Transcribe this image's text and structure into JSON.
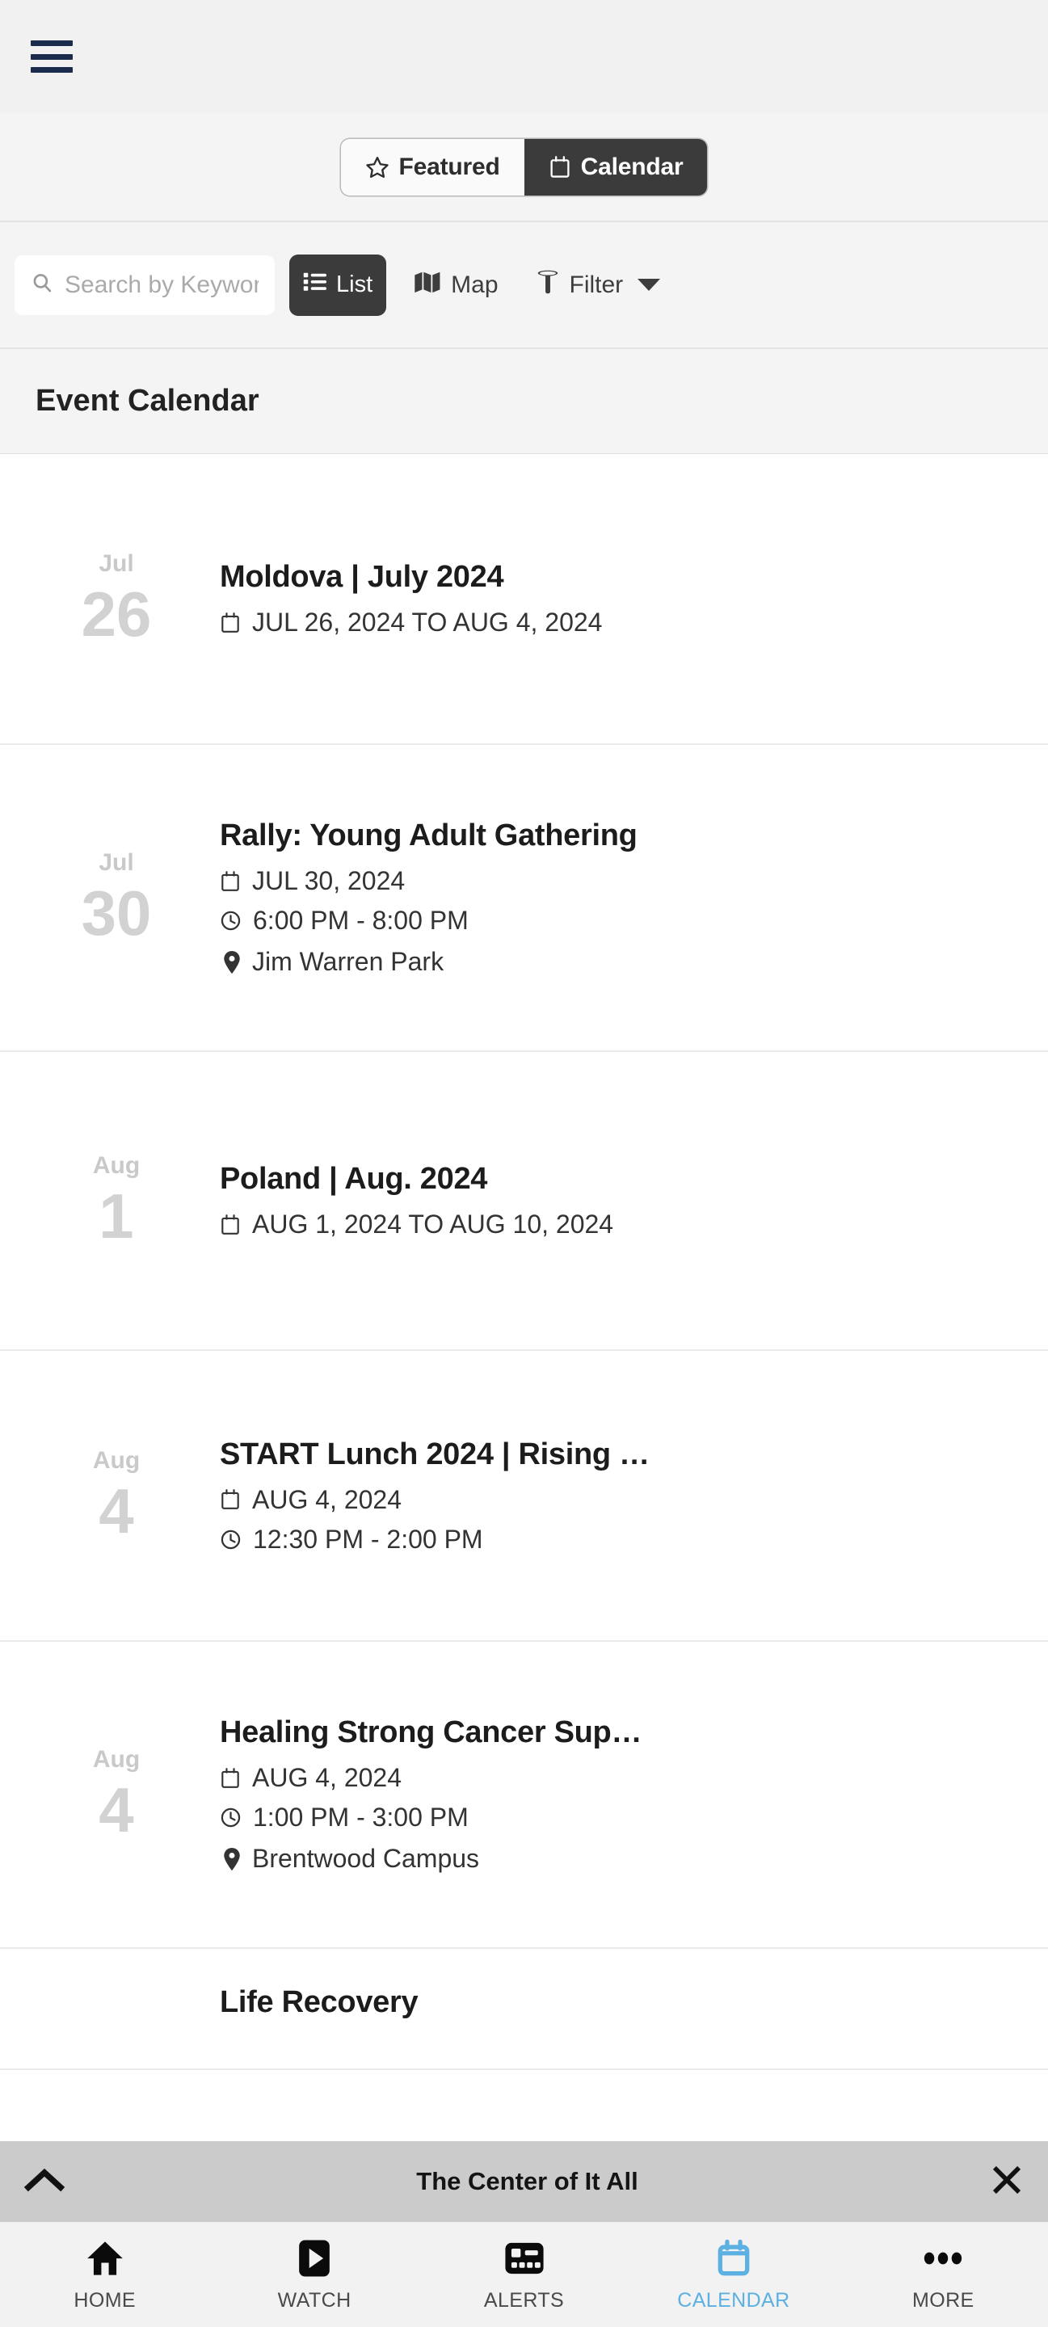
{
  "colors": {
    "accent": "#5cb0e2",
    "dark_button": "#3b3b3b",
    "hamburger": "#1b2b4b",
    "banner_bg": "#cbcbcb",
    "page_bg": "#f4f4f4",
    "date_gray": "#d2d2d2"
  },
  "header": {
    "menu_icon": "hamburger-menu-icon"
  },
  "segmented": {
    "featured": {
      "label": "Featured",
      "icon": "star-icon",
      "active": false
    },
    "calendar": {
      "label": "Calendar",
      "icon": "calendar-icon",
      "active": true
    }
  },
  "search": {
    "placeholder": "Search by Keyword",
    "value": "",
    "icon": "search-icon"
  },
  "view_controls": {
    "list": {
      "label": "List",
      "icon": "list-icon",
      "active": true
    },
    "map": {
      "label": "Map",
      "icon": "map-icon",
      "active": false
    },
    "filter": {
      "label": "Filter",
      "icon": "funnel-icon",
      "caret": "chevron-down-icon"
    }
  },
  "page_title": "Event Calendar",
  "events": [
    {
      "month": "Jul",
      "day": "26",
      "title": "Moldova | July 2024",
      "date": "JUL 26, 2024 TO AUG 4, 2024",
      "time": "",
      "location": ""
    },
    {
      "month": "Jul",
      "day": "30",
      "title": "Rally: Young Adult Gathering",
      "date": "JUL 30, 2024",
      "time": "6:00 PM - 8:00 PM",
      "location": "Jim Warren Park"
    },
    {
      "month": "Aug",
      "day": "1",
      "title": "Poland | Aug. 2024",
      "date": "AUG 1, 2024 TO AUG 10, 2024",
      "time": "",
      "location": ""
    },
    {
      "month": "Aug",
      "day": "4",
      "title": "START Lunch 2024 | Rising …",
      "date": "AUG 4, 2024",
      "time": "12:30 PM - 2:00 PM",
      "location": ""
    },
    {
      "month": "Aug",
      "day": "4",
      "title": "Healing Strong Cancer Sup…",
      "date": "AUG 4, 2024",
      "time": "1:00 PM - 3:00 PM",
      "location": "Brentwood Campus"
    },
    {
      "month": "",
      "day": "",
      "title": "Life Recovery",
      "date": "",
      "time": "",
      "location": ""
    }
  ],
  "banner": {
    "label": "The Center of It All",
    "expand_icon": "chevron-up-icon",
    "close_icon": "close-icon"
  },
  "tabbar": [
    {
      "label": "HOME",
      "icon": "home-icon",
      "active": false
    },
    {
      "label": "WATCH",
      "icon": "play-icon",
      "active": false
    },
    {
      "label": "ALERTS",
      "icon": "alerts-icon",
      "active": false
    },
    {
      "label": "CALENDAR",
      "icon": "calendar-icon",
      "active": true
    },
    {
      "label": "MORE",
      "icon": "ellipsis-icon",
      "active": false
    }
  ]
}
